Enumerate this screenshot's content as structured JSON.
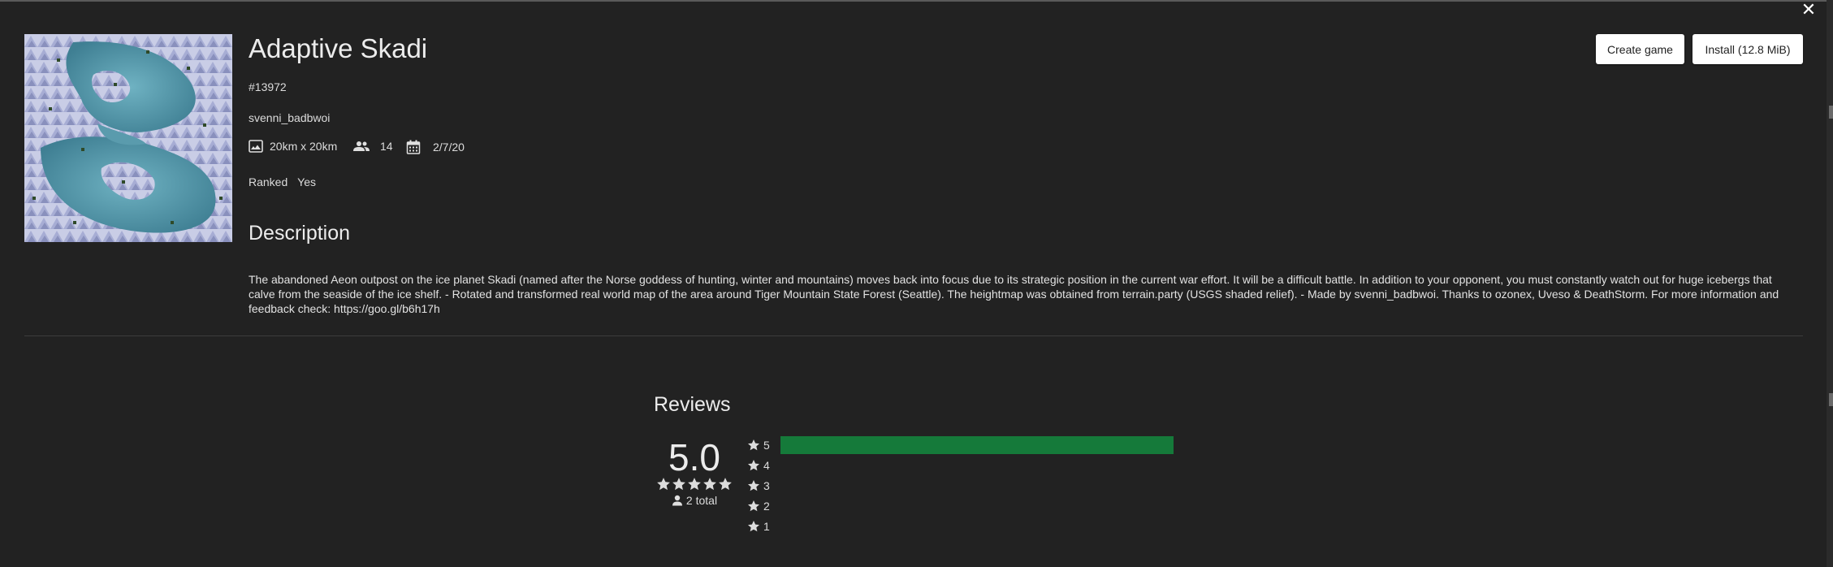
{
  "window": {
    "close_label": "✕"
  },
  "map": {
    "title": "Adaptive Skadi",
    "id": "#13972",
    "author": "svenni_badbwoi",
    "size": "20km x 20km",
    "players": "14",
    "date": "2/7/20",
    "ranked_label": "Ranked",
    "ranked_value": "Yes",
    "thumbnail_icon": "map-thumbnail-image"
  },
  "actions": {
    "create_game": "Create game",
    "install": "Install (12.8 MiB)"
  },
  "description": {
    "heading": "Description",
    "text": "The abandoned Aeon outpost on the ice planet Skadi (named after the Norse goddess of hunting, winter and mountains) moves back into focus due to its strategic position in the current war effort. It will be a difficult battle. In addition to your opponent, you must constantly watch out for huge icebergs that calve from the seaside of the ice shelf. - Rotated and transformed real world map of the area around Tiger Mountain State Forest (Seattle). The heightmap was obtained from terrain.party (USGS shaded relief). - Made by svenni_badbwoi. Thanks to ozonex, Uveso & DeathStorm. For more information and feedback check: https://goo.gl/b6h17h"
  },
  "reviews": {
    "heading": "Reviews",
    "score": "5.0",
    "total": "2 total",
    "stars_filled": 5,
    "accent_color": "#157a3a",
    "rows": [
      {
        "label": "5",
        "fraction": 1.0
      },
      {
        "label": "4",
        "fraction": 0
      },
      {
        "label": "3",
        "fraction": 0
      },
      {
        "label": "2",
        "fraction": 0
      },
      {
        "label": "1",
        "fraction": 0
      }
    ]
  }
}
